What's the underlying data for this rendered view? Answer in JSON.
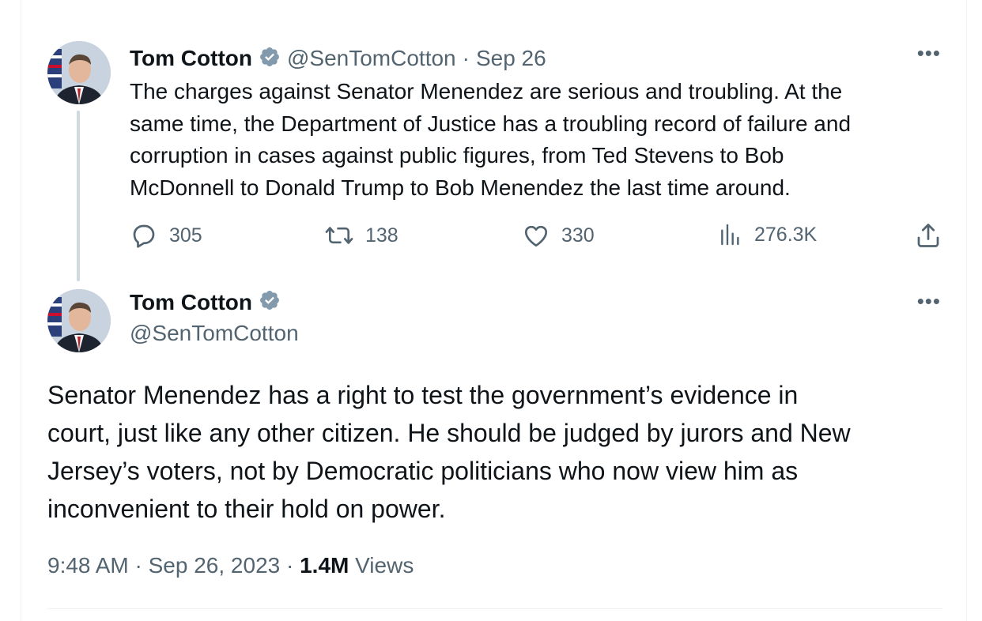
{
  "accent_color": "#1d9bf0",
  "muted_color": "#536471",
  "thread": {
    "reply": {
      "author_name": "Tom Cotton",
      "author_handle": "@SenTomCotton",
      "date": "Sep 26",
      "more_icon": "more-horizontal-icon",
      "text": "The charges against Senator Menendez are serious and troubling. At the\nsame time, the Department of Justice has a troubling record of failure and\ncorruption in cases against public figures, from Ted Stevens to Bob\nMcDonnell to Donald Trump to Bob Menendez the last time around.",
      "actions": {
        "replies": "305",
        "reposts": "138",
        "likes": "330",
        "views": "276.3K"
      }
    },
    "main": {
      "author_name": "Tom Cotton",
      "author_handle": "@SenTomCotton",
      "more_icon": "more-horizontal-icon",
      "text": "Senator Menendez has a right to test the government’s evidence in\ncourt, just like any other citizen. He should be judged by jurors and New\nJersey’s voters, not by Democratic politicians who now view him as\ninconvenient to their hold on power.",
      "time": "9:48 AM",
      "full_date": "Sep 26, 2023",
      "views_count": "1.4M",
      "views_label": "Views"
    }
  }
}
